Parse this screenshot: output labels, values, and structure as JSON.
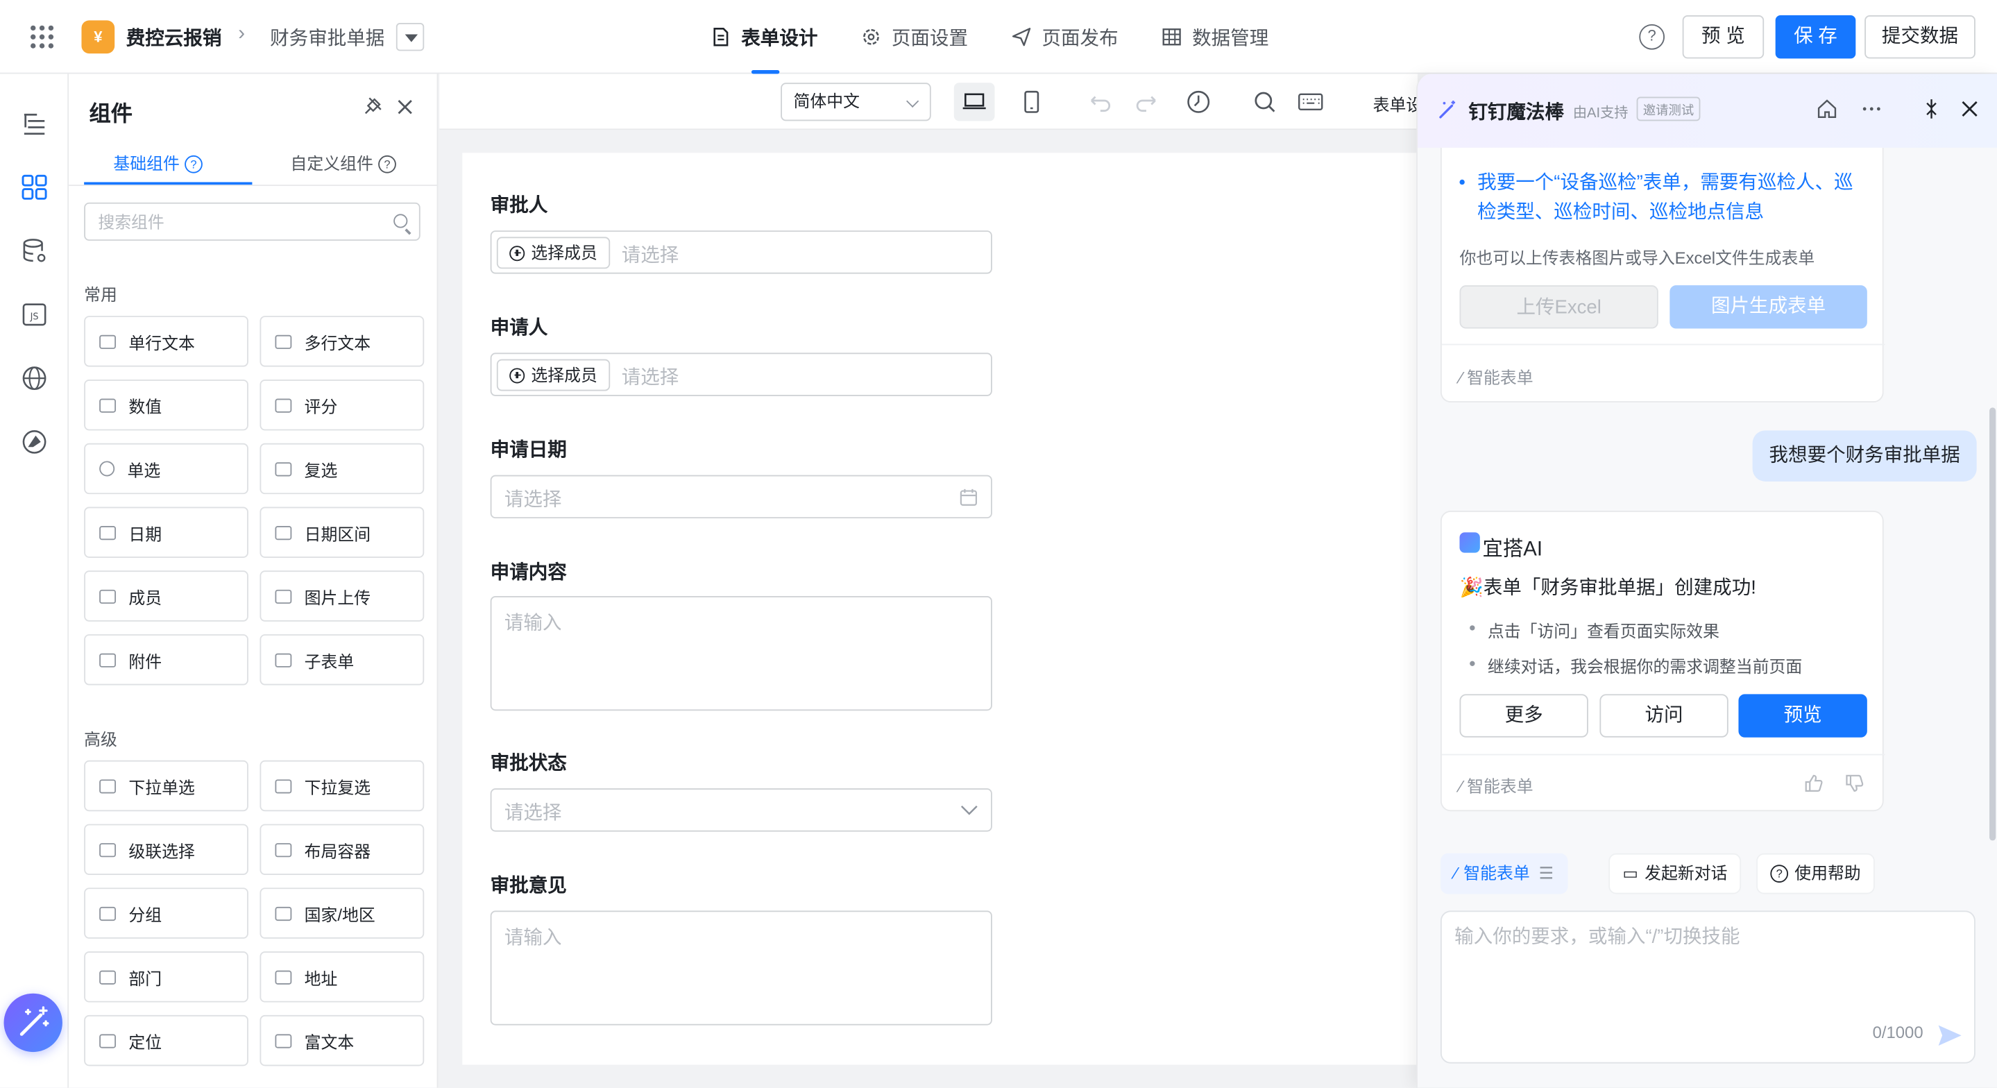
{
  "topbar": {
    "app_logo_text": "¥",
    "app_name": "费控云报销",
    "breadcrumb_sep": "›",
    "page_name": "财务审批单据",
    "nav": [
      "表单设计",
      "页面设置",
      "页面发布",
      "数据管理"
    ],
    "help": "?",
    "preview": "预 览",
    "save": "保 存",
    "submit": "提交数据"
  },
  "rail": {
    "code": "<>"
  },
  "panel": {
    "title": "组件",
    "tab_basic": "基础组件",
    "tab_custom": "自定义组件",
    "search_placeholder": "搜索组件",
    "group_common": "常用",
    "common": [
      "单行文本",
      "多行文本",
      "数值",
      "评分",
      "单选",
      "复选",
      "日期",
      "日期区间",
      "成员",
      "图片上传",
      "附件",
      "子表单"
    ],
    "group_advanced": "高级",
    "advanced": [
      "下拉单选",
      "下拉复选",
      "级联选择",
      "布局容器",
      "分组",
      "国家/地区",
      "部门",
      "地址",
      "定位",
      "富文本"
    ]
  },
  "canvas": {
    "language": "简体中文",
    "toolbar_label": "表单设"
  },
  "form": {
    "fields": [
      {
        "label": "审批人",
        "type": "member",
        "button": "选择成员",
        "placeholder": "请选择"
      },
      {
        "label": "申请人",
        "type": "member",
        "button": "选择成员",
        "placeholder": "请选择"
      },
      {
        "label": "申请日期",
        "type": "date",
        "placeholder": "请选择"
      },
      {
        "label": "申请内容",
        "type": "textarea",
        "placeholder": "请输入"
      },
      {
        "label": "审批状态",
        "type": "select",
        "placeholder": "请选择"
      },
      {
        "label": "审批意见",
        "type": "textarea",
        "placeholder": "请输入"
      }
    ]
  },
  "ai": {
    "title": "钉钉魔法棒",
    "subtitle": "由AI支持",
    "badge": "邀请测试",
    "suggestion": "我要一个“设备巡检”表单，需要有巡检人、巡检类型、巡检时间、巡检地点信息",
    "hint": "你也可以上传表格图片或导入Excel文件生成表单",
    "upload_excel": "上传Excel",
    "image_form": "图片生成表单",
    "footer_label": "智能表单",
    "user_message": "我想要个财务审批单据",
    "bot_name": "宜搭AI",
    "success": "🎉表单「财务审批单据」创建成功!",
    "tips": [
      "点击「访问」查看页面实际效果",
      "继续对话，我会根据你的需求调整当前页面"
    ],
    "actions": [
      "更多",
      "访问",
      "预览"
    ],
    "chips": [
      "智能表单",
      "发起新对话",
      "使用帮助"
    ],
    "input_placeholder": "输入你的要求，或输入“/”切换技能",
    "counter": "0/1000"
  }
}
